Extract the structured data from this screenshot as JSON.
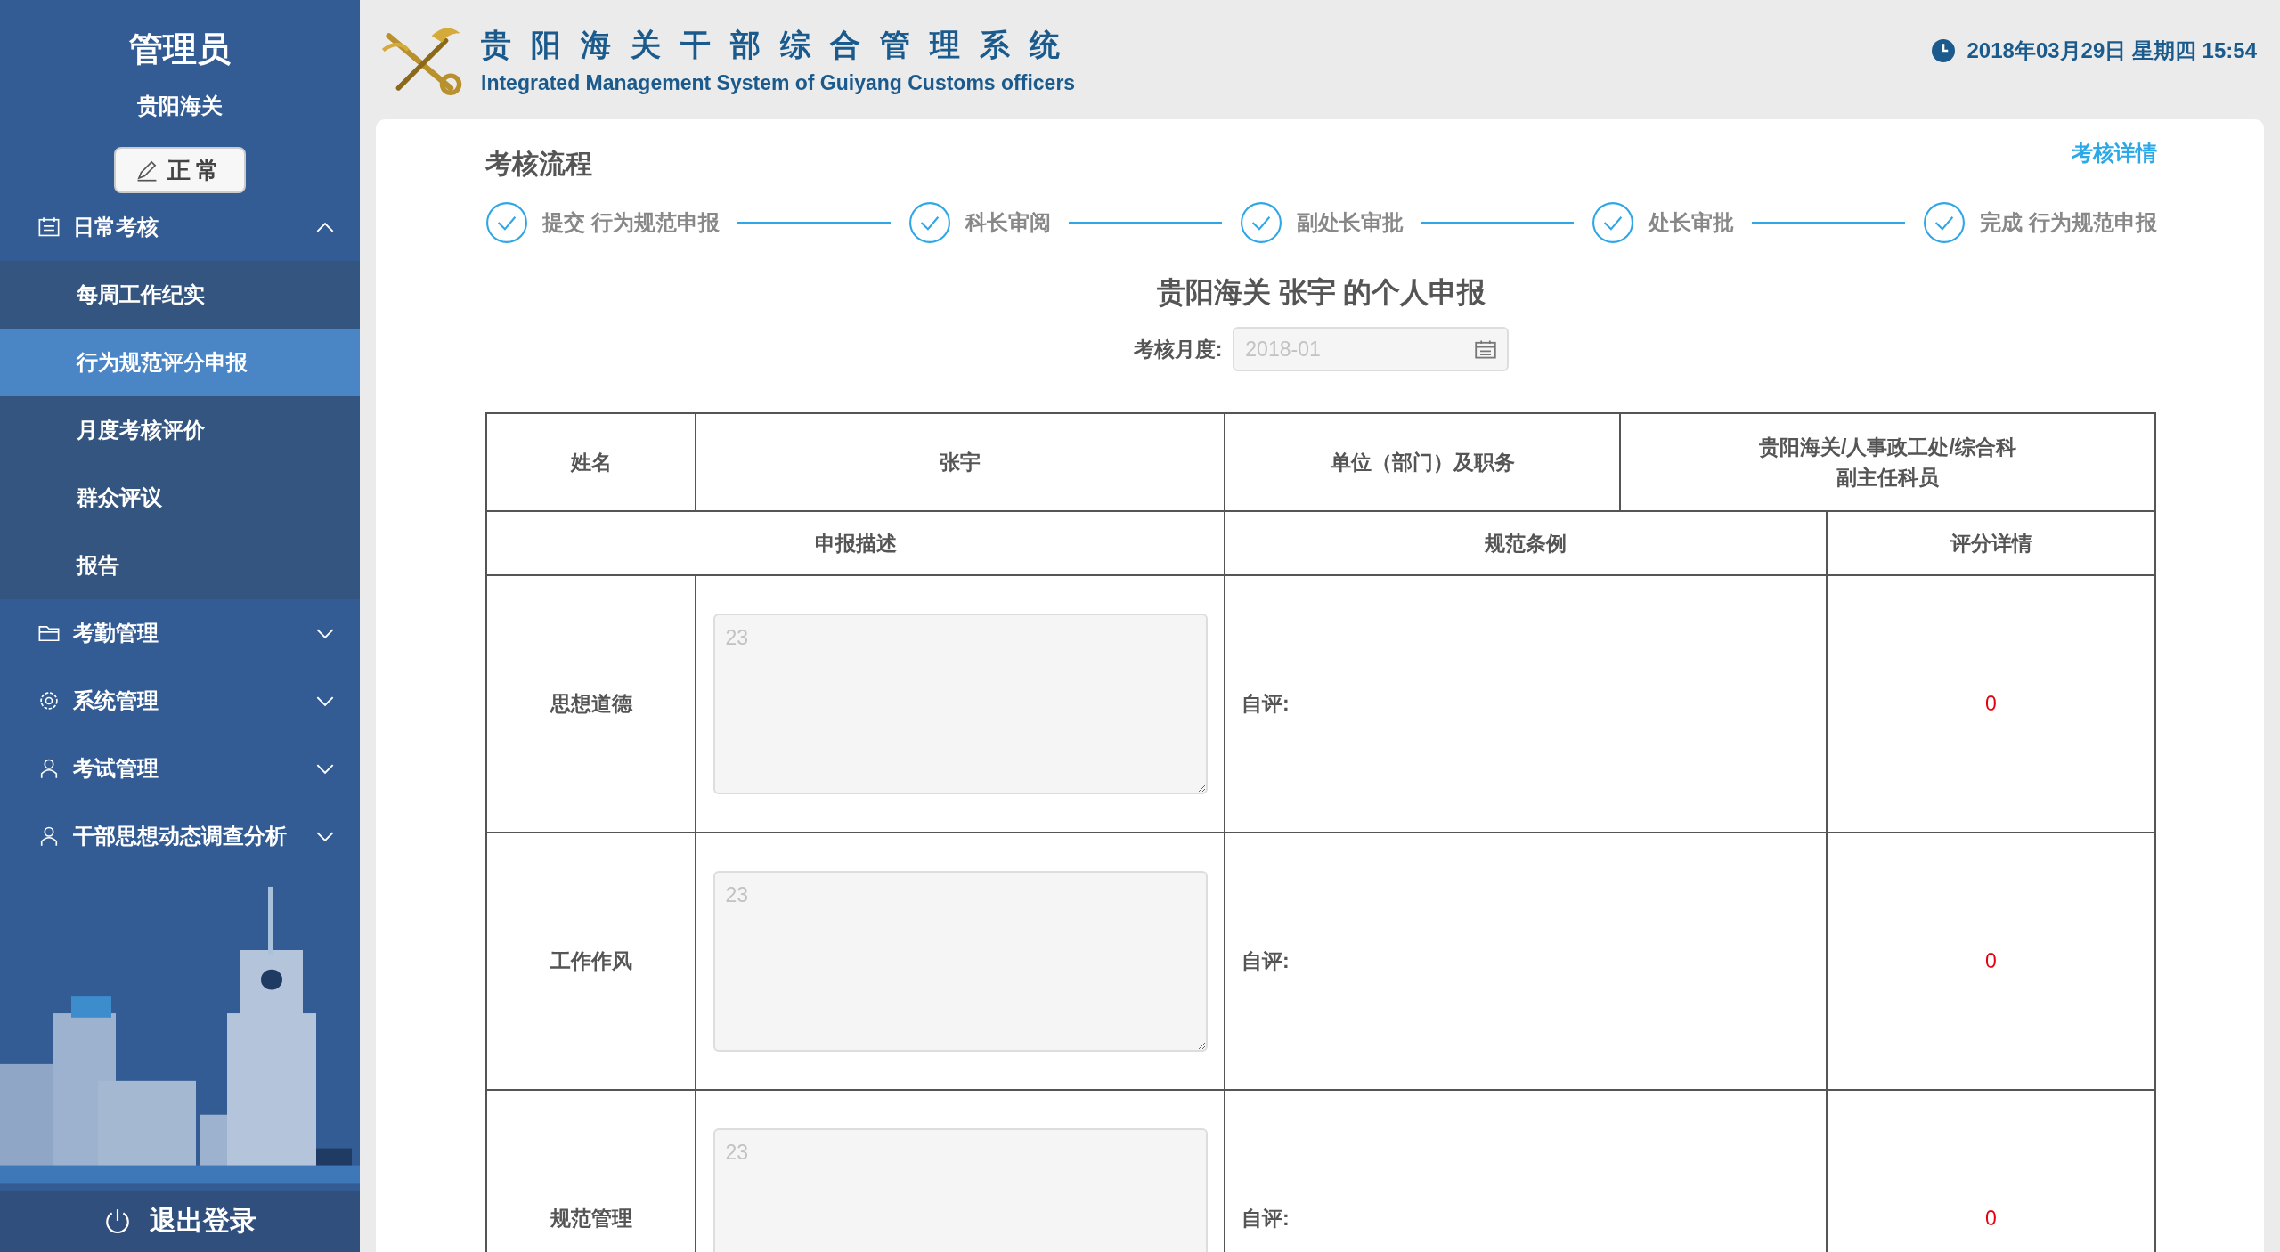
{
  "sidebar": {
    "user_title": "管理员",
    "org": "贵阳海关",
    "status_button": "正常",
    "menu": [
      {
        "kind": "calendar",
        "label": "日常考核",
        "expanded": true,
        "children": [
          {
            "label": "每周工作纪实",
            "selected": false
          },
          {
            "label": "行为规范评分申报",
            "selected": true
          },
          {
            "label": "月度考核评价",
            "selected": false
          },
          {
            "label": "群众评议",
            "selected": false
          },
          {
            "label": "报告",
            "selected": false
          }
        ]
      },
      {
        "kind": "folder",
        "label": "考勤管理",
        "expanded": false
      },
      {
        "kind": "gear",
        "label": "系统管理",
        "expanded": false
      },
      {
        "kind": "person",
        "label": "考试管理",
        "expanded": false
      },
      {
        "kind": "person",
        "label": "干部思想动态调查分析",
        "expanded": false
      }
    ],
    "logout": "退出登录"
  },
  "header": {
    "title": "贵阳海关干部综合管理系统",
    "subtitle": "Integrated Management System of Guiyang Customs officers",
    "datetime": "2018年03月29日 星期四 15:54"
  },
  "process": {
    "title": "考核流程",
    "detail_link": "考核详情",
    "steps": [
      {
        "label": "提交 行为规范申报",
        "done": true
      },
      {
        "label": "科长审阅",
        "done": true
      },
      {
        "label": "副处长审批",
        "done": true
      },
      {
        "label": "处长审批",
        "done": true
      },
      {
        "label": "完成 行为规范申报",
        "done": true
      }
    ]
  },
  "form": {
    "heading": "贵阳海关 张宇 的个人申报",
    "month_label": "考核月度:",
    "month_value": "2018-01",
    "info": {
      "name_label": "姓名",
      "name": "张宇",
      "unit_label": "单位（部门）及职务",
      "unit_lines": [
        "贵阳海关/人事政工处/综合科",
        "副主任科员"
      ]
    },
    "columns": [
      "申报描述",
      "规范条例",
      "评分详情"
    ],
    "rows": [
      {
        "category": "思想道德",
        "description": "23",
        "disabled": true,
        "self_label": "自评:",
        "score": "0"
      },
      {
        "category": "工作作风",
        "description": "23",
        "disabled": true,
        "self_label": "自评:",
        "score": "0"
      },
      {
        "category": "规范管理",
        "description": "23",
        "disabled": true,
        "self_label": "自评:",
        "score": "0"
      }
    ]
  }
}
